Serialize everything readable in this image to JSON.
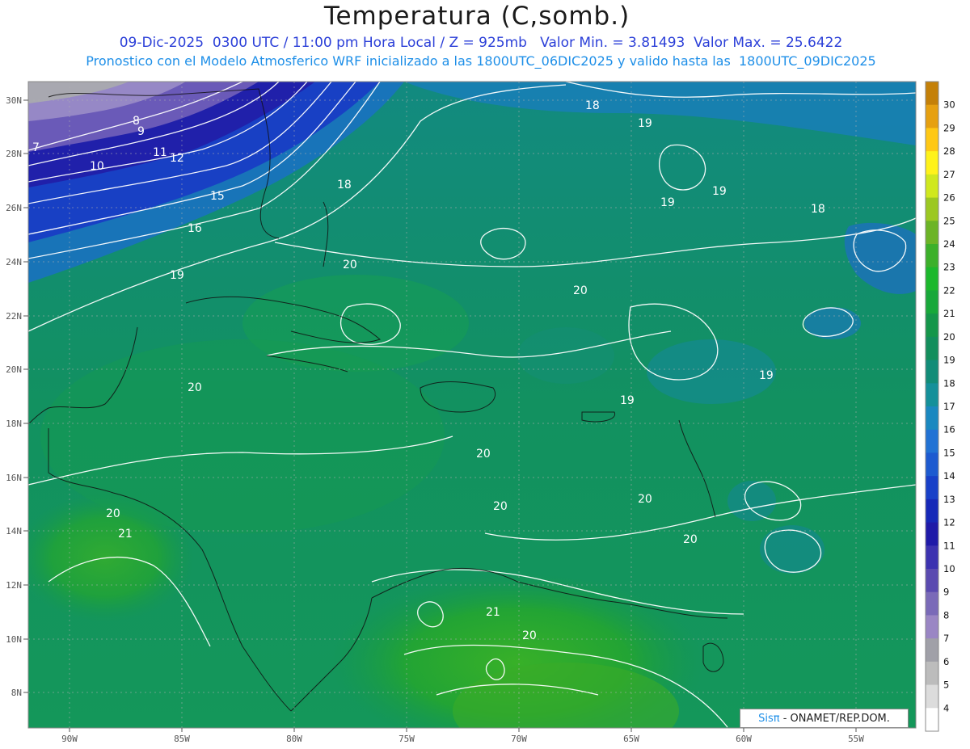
{
  "header": {
    "title": "Temperatura (C,somb.)",
    "line1": "09-Dic-2025  0300 UTC / 11:00 pm Hora Local / Z = 925mb   Valor Min. = 3.81493  Valor Max. = 25.6422",
    "line2": "Pronostico con el Modelo Atmosferico WRF inicializado a las 1800UTC_06DIC2025 y valido hasta las  1800UTC_09DIC2025"
  },
  "map": {
    "lat_ticks": [
      "30N",
      "28N",
      "26N",
      "24N",
      "22N",
      "20N",
      "18N",
      "16N",
      "14N",
      "12N",
      "10N",
      "8N"
    ],
    "lon_ticks": [
      "90W",
      "85W",
      "80W",
      "75W",
      "70W",
      "65W",
      "60W",
      "55W"
    ],
    "contour_labels": [
      "7",
      "8",
      "9",
      "10",
      "11",
      "12",
      "15",
      "16",
      "18",
      "18",
      "18",
      "19",
      "19",
      "19",
      "19",
      "19",
      "19",
      "20",
      "20",
      "20",
      "20",
      "20",
      "20",
      "20",
      "20",
      "20",
      "21",
      "21"
    ]
  },
  "colorbar": {
    "labels": [
      "4",
      "5",
      "6",
      "7",
      "8",
      "9",
      "10",
      "11",
      "12",
      "13",
      "14",
      "15",
      "16",
      "17",
      "18",
      "19",
      "20",
      "21",
      "22",
      "23",
      "24",
      "25",
      "26",
      "27",
      "28",
      "29",
      "30"
    ],
    "colors": [
      "#ffffff",
      "#dcdcdc",
      "#bcbcbc",
      "#a0a0a8",
      "#9a86c4",
      "#7a6ab8",
      "#5a4ab0",
      "#3c32b0",
      "#1f1aa8",
      "#1628b8",
      "#1840c8",
      "#1d5ad0",
      "#2172d4",
      "#1a88c0",
      "#14909a",
      "#118c78",
      "#138e5c",
      "#15964a",
      "#18a83a",
      "#1cb82c",
      "#3cb02a",
      "#6cb426",
      "#9cc822",
      "#d0e81e",
      "#fff21a",
      "#ffc814",
      "#e6a010",
      "#c48008"
    ]
  },
  "credit": {
    "brand": "Sisπ",
    "text": " - ONAMET/REP.DOM."
  }
}
